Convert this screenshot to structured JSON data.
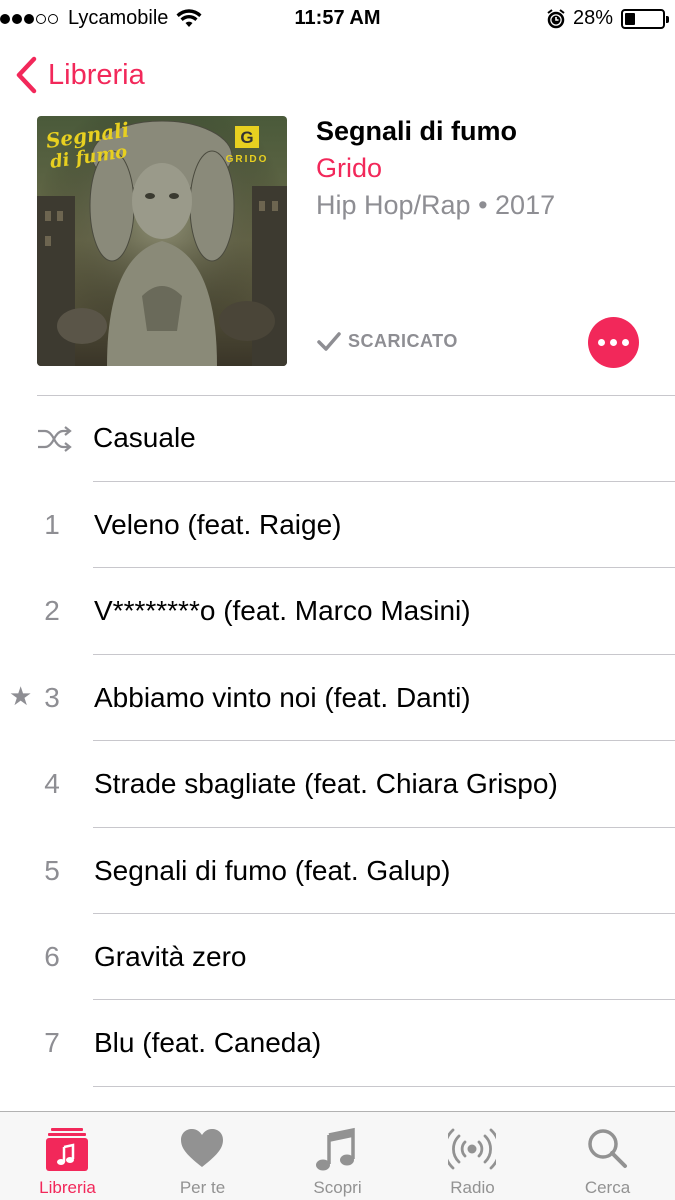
{
  "status_bar": {
    "carrier": "Lycamobile",
    "time": "11:57 AM",
    "battery_pct": "28%",
    "battery_level": 0.28,
    "signal_bars": 3,
    "icons": [
      "wifi-icon",
      "alarm-icon",
      "battery-icon"
    ]
  },
  "nav": {
    "back_label": "Libreria"
  },
  "album": {
    "title": "Segnali di fumo",
    "artist": "Grido",
    "meta": "Hip Hop/Rap • 2017",
    "downloaded_label": "SCARICATO",
    "art_text_1": "Segnali di fumo",
    "art_text_2": "GRIDO"
  },
  "shuffle": {
    "label": "Casuale"
  },
  "tracks": [
    {
      "num": "1",
      "title": "Veleno (feat. Raige)",
      "starred": false
    },
    {
      "num": "2",
      "title": "V********o (feat. Marco Masini)",
      "starred": false
    },
    {
      "num": "3",
      "title": "Abbiamo vinto noi (feat. Danti)",
      "starred": true
    },
    {
      "num": "4",
      "title": "Strade sbagliate (feat. Chiara Grispo)",
      "starred": false
    },
    {
      "num": "5",
      "title": "Segnali di fumo (feat. Galup)",
      "starred": false
    },
    {
      "num": "6",
      "title": "Gravità zero",
      "starred": false
    },
    {
      "num": "7",
      "title": "Blu (feat. Caneda)",
      "starred": false
    }
  ],
  "tab_bar": {
    "items": [
      {
        "label": "Libreria",
        "icon": "library-icon",
        "active": true
      },
      {
        "label": "Per te",
        "icon": "heart-icon",
        "active": false
      },
      {
        "label": "Scopri",
        "icon": "music-note-icon",
        "active": false
      },
      {
        "label": "Radio",
        "icon": "radio-icon",
        "active": false
      },
      {
        "label": "Cerca",
        "icon": "search-icon",
        "active": false
      }
    ]
  },
  "colors": {
    "accent": "#f2285a",
    "secondary_text": "#8e8e93",
    "separator": "#c8c7cc"
  }
}
